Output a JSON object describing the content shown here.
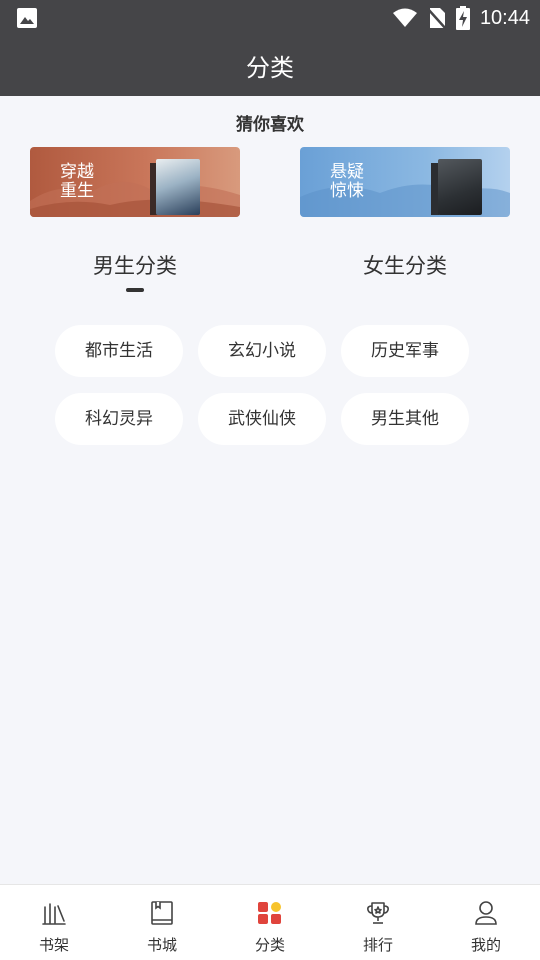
{
  "status": {
    "time": "10:44"
  },
  "header": {
    "title": "分类"
  },
  "guess": {
    "title": "猜你喜欢",
    "cards": [
      {
        "line1": "穿越",
        "line2": "重生"
      },
      {
        "line1": "悬疑",
        "line2": "惊悚"
      }
    ]
  },
  "tabs": {
    "male": "男生分类",
    "female": "女生分类",
    "selected": "male"
  },
  "categories": [
    "都市生活",
    "玄幻小说",
    "历史军事",
    "科幻灵异",
    "武侠仙侠",
    "男生其他"
  ],
  "nav": [
    {
      "label": "书架",
      "icon": "bookshelf-icon"
    },
    {
      "label": "书城",
      "icon": "book-icon"
    },
    {
      "label": "分类",
      "icon": "category-grid-icon",
      "active": true
    },
    {
      "label": "排行",
      "icon": "trophy-icon"
    },
    {
      "label": "我的",
      "icon": "user-icon"
    }
  ],
  "colors": {
    "appbar": "#454548",
    "background": "#f5f6fa",
    "accent_red": "#e0443c",
    "accent_yellow": "#f7c32c"
  }
}
